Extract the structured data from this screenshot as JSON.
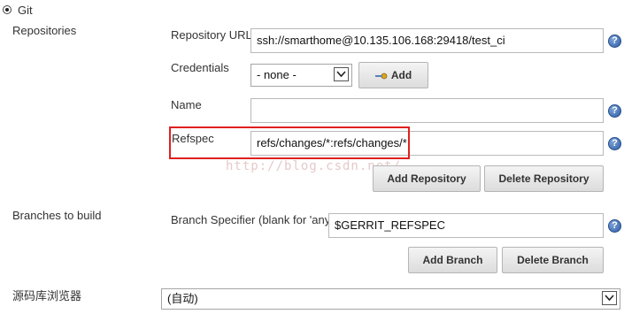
{
  "scm": {
    "option_label": "Git"
  },
  "repositories": {
    "section_label": "Repositories",
    "repository_url_label": "Repository URL",
    "repository_url_value": "ssh://smarthome@10.135.106.168:29418/test_ci",
    "credentials_label": "Credentials",
    "credentials_value": "- none -",
    "add_label": "Add",
    "name_label": "Name",
    "name_value": "",
    "refspec_label": "Refspec",
    "refspec_value": "refs/changes/*:refs/changes/*",
    "add_repository_label": "Add Repository",
    "delete_repository_label": "Delete Repository"
  },
  "branches": {
    "section_label": "Branches to build",
    "specifier_label": "Branch Specifier (blank for 'any')",
    "specifier_value": "$GERRIT_REFSPEC",
    "add_branch_label": "Add Branch",
    "delete_branch_label": "Delete Branch"
  },
  "browser": {
    "section_label": "源码库浏览器",
    "value": "(自动)"
  },
  "help_glyph": "?",
  "watermark_text": "http://blog.csdn.net/",
  "colors": {
    "highlight": "#e02020",
    "help_icon": "#2d5ea8"
  }
}
